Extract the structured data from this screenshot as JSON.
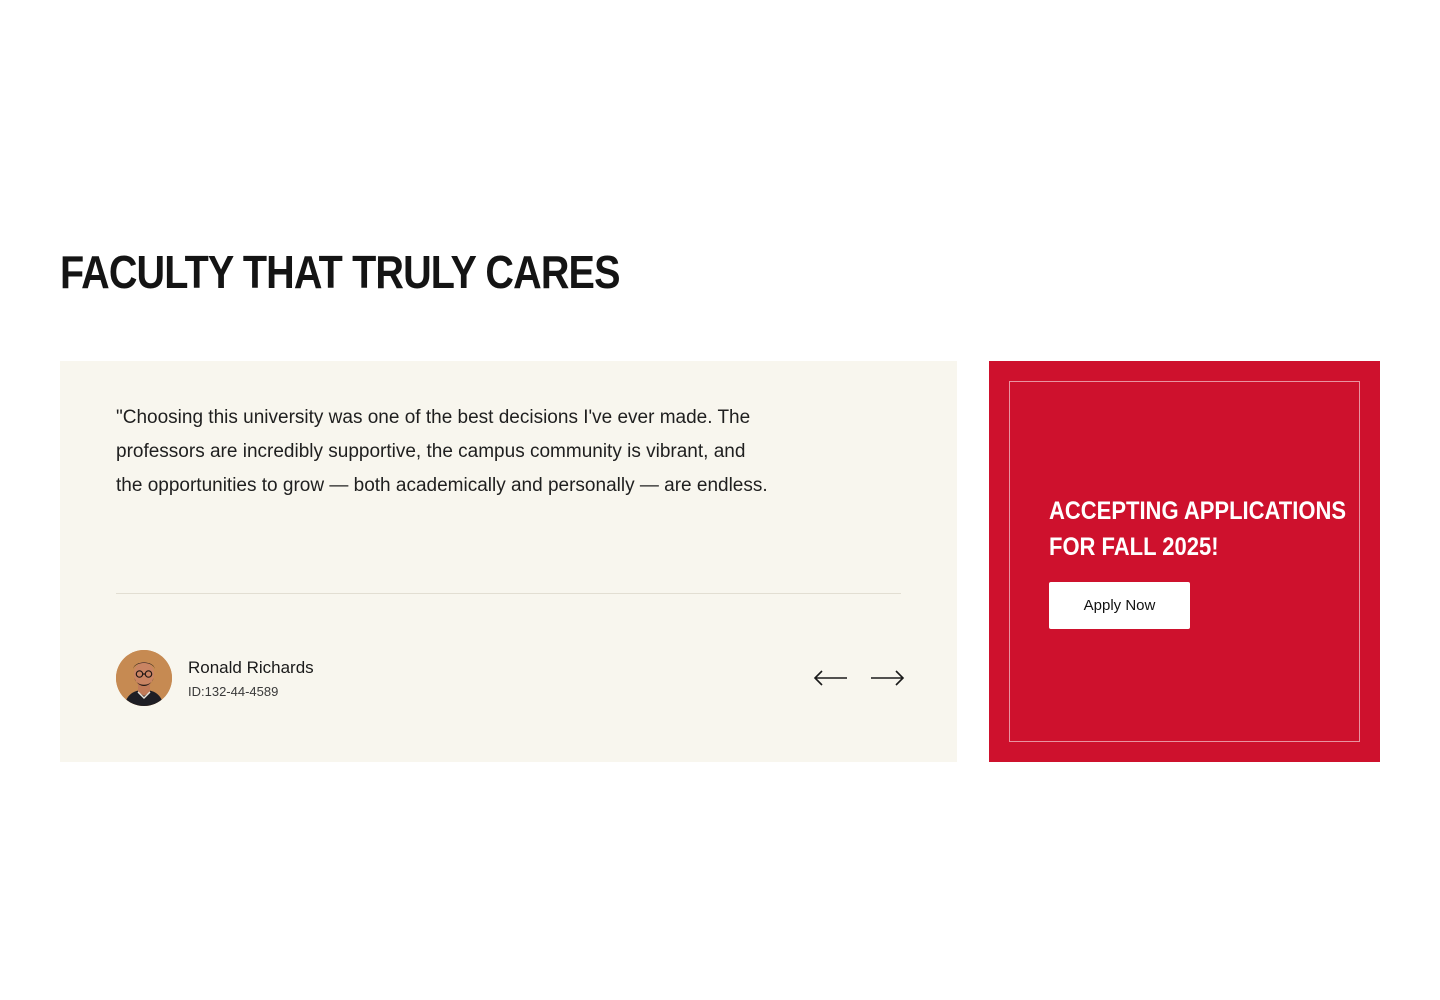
{
  "section": {
    "title": "FACULTY THAT TRULY CARES"
  },
  "testimonial": {
    "quote": "\"Choosing this university was one of the best decisions I've ever made. The professors are incredibly supportive, the campus community is vibrant, and the opportunities to grow — both academically and personally — are endless.",
    "author_name": "Ronald Richards",
    "author_id": "ID:132-44-4589",
    "avatar_icon": "person-avatar",
    "prev_icon": "arrow-left-icon",
    "next_icon": "arrow-right-icon"
  },
  "apply": {
    "heading_line1": "ACCEPTING APPLICATIONS",
    "heading_line2": "FOR FALL 2025!",
    "button_label": "Apply Now"
  },
  "colors": {
    "accent_red": "#ce112d",
    "card_cream": "#f8f6ee",
    "heading_dark": "#141414"
  }
}
